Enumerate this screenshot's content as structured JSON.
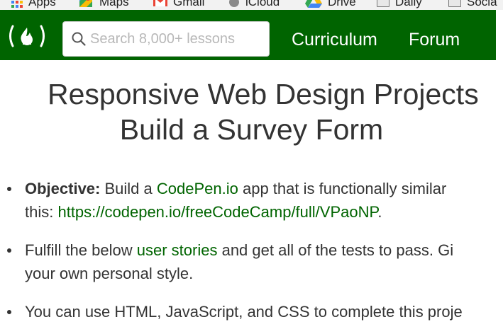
{
  "bookmarks": [
    {
      "label": "Apps",
      "icon": "apps-grid-icon"
    },
    {
      "label": "Maps",
      "icon": "maps-pin-icon"
    },
    {
      "label": "Gmail",
      "icon": "gmail-icon"
    },
    {
      "label": "iCloud",
      "icon": "apple-icon"
    },
    {
      "label": "Drive",
      "icon": "drive-icon"
    },
    {
      "label": "Daily",
      "icon": "folder-icon"
    },
    {
      "label": "Socia",
      "icon": "folder-icon"
    }
  ],
  "nav": {
    "logo_text": "(🔥)",
    "search_placeholder": "Search 8,000+ lessons",
    "links": [
      "Curriculum",
      "Forum"
    ]
  },
  "page": {
    "title_line1": "Responsive Web Design Projects",
    "title_line2": "Build a Survey Form"
  },
  "items": [
    {
      "label": "Objective:",
      "t1": " Build a ",
      "link1": "CodePen.io",
      "t2": " app that is functionally similar",
      "line2_text": "this: ",
      "link2": "https://codepen.io/freeCodeCamp/full/VPaoNP",
      "t3": "."
    },
    {
      "t1": "Fulfill the below ",
      "link1": "user stories",
      "t2": " and get all of the tests to pass. Gi",
      "line2_text": "your own personal style."
    },
    {
      "t1": "You can use HTML, JavaScript, and CSS to complete this proje"
    }
  ],
  "colors": {
    "nav_bg": "#006400",
    "link": "#006400",
    "text": "#333333"
  }
}
